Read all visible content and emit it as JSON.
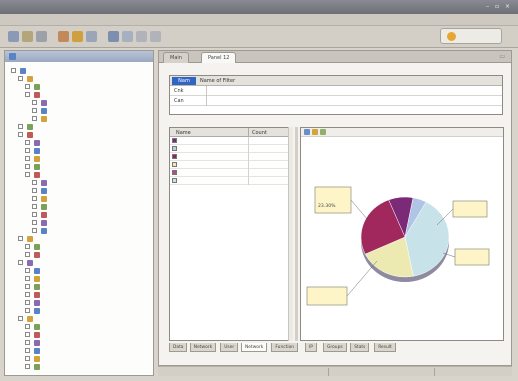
{
  "window": {
    "title": "",
    "controls": "– ▫ ×"
  },
  "menubar": {
    "items": [
      "",
      "",
      "",
      "",
      "",
      "",
      "",
      ""
    ]
  },
  "perspective": {
    "label": ""
  },
  "left_pane": {
    "tab_label": "",
    "tree": [
      {
        "label": "",
        "depth": 0,
        "expanded": true
      },
      {
        "label": "",
        "depth": 1,
        "expanded": true
      },
      {
        "label": "",
        "depth": 2,
        "expanded": false
      },
      {
        "label": "",
        "depth": 2,
        "expanded": true
      },
      {
        "label": "",
        "depth": 3,
        "expanded": false
      },
      {
        "label": "",
        "depth": 3,
        "expanded": false
      },
      {
        "label": "",
        "depth": 3,
        "expanded": false
      },
      {
        "label": "",
        "depth": 1,
        "expanded": false
      },
      {
        "label": "",
        "depth": 1,
        "expanded": true
      },
      {
        "label": "",
        "depth": 2,
        "expanded": false
      },
      {
        "label": "",
        "depth": 2,
        "expanded": false
      },
      {
        "label": "",
        "depth": 2,
        "expanded": false
      },
      {
        "label": "",
        "depth": 2,
        "expanded": false
      },
      {
        "label": "",
        "depth": 2,
        "expanded": false
      },
      {
        "label": "",
        "depth": 3,
        "expanded": false
      },
      {
        "label": "",
        "depth": 3,
        "expanded": false
      },
      {
        "label": "",
        "depth": 3,
        "expanded": false
      },
      {
        "label": "",
        "depth": 3,
        "expanded": false
      },
      {
        "label": "",
        "depth": 3,
        "expanded": false
      },
      {
        "label": "",
        "depth": 3,
        "expanded": false
      },
      {
        "label": "",
        "depth": 3,
        "expanded": false
      },
      {
        "label": "",
        "depth": 1,
        "expanded": true
      },
      {
        "label": "",
        "depth": 2,
        "expanded": false
      },
      {
        "label": "",
        "depth": 2,
        "expanded": false
      },
      {
        "label": "",
        "depth": 1,
        "expanded": true
      },
      {
        "label": "",
        "depth": 2,
        "expanded": false
      },
      {
        "label": "",
        "depth": 2,
        "expanded": false
      },
      {
        "label": "",
        "depth": 2,
        "expanded": false
      },
      {
        "label": "",
        "depth": 2,
        "expanded": false
      },
      {
        "label": "",
        "depth": 2,
        "expanded": false
      },
      {
        "label": "",
        "depth": 2,
        "expanded": false
      },
      {
        "label": "",
        "depth": 1,
        "expanded": true
      },
      {
        "label": "",
        "depth": 2,
        "expanded": false
      },
      {
        "label": "",
        "depth": 2,
        "expanded": false
      },
      {
        "label": "",
        "depth": 2,
        "expanded": false
      },
      {
        "label": "",
        "depth": 2,
        "expanded": false
      },
      {
        "label": "",
        "depth": 2,
        "expanded": false
      },
      {
        "label": "",
        "depth": 2,
        "expanded": false
      }
    ]
  },
  "editor": {
    "tabs": [
      {
        "label": "Main",
        "active": false
      },
      {
        "label": "Panel 12",
        "active": true
      }
    ],
    "section_title": "",
    "properties": {
      "header": {
        "name": "Nam",
        "value": "Name of Filter"
      },
      "rows": [
        {
          "key": "Cnk",
          "value": ""
        },
        {
          "key": "Can",
          "value": ""
        }
      ]
    },
    "section2_title": "",
    "grid": {
      "columns": [
        "Name",
        "Count"
      ],
      "rows": [
        {
          "name": "",
          "value": "",
          "color": "#7b2a78"
        },
        {
          "name": "",
          "value": "",
          "color": "#b7cfe6"
        },
        {
          "name": "",
          "value": "",
          "color": "#8d2455"
        },
        {
          "name": "",
          "value": "",
          "color": "#efeab2"
        },
        {
          "name": "",
          "value": "",
          "color": "#b84884"
        },
        {
          "name": "",
          "value": "",
          "color": "#c8e2ea"
        }
      ]
    },
    "bottom_tabs": [
      {
        "label": "Data",
        "active": false
      },
      {
        "label": "Network",
        "active": false
      },
      {
        "label": "User",
        "active": false
      },
      {
        "label": "Network",
        "active": true
      },
      {
        "label": "Function",
        "active": false
      },
      {
        "label": "IP",
        "active": false
      },
      {
        "label": "Groups",
        "active": false
      },
      {
        "label": "Stats",
        "active": false
      },
      {
        "label": "Result",
        "active": false
      }
    ]
  },
  "status": {
    "segments": [
      "",
      "",
      ""
    ]
  },
  "colors": {
    "accent": "#3164c4",
    "pie_slices": [
      "#c8e2ea",
      "#eceab0",
      "#a0285d",
      "#7b2a78",
      "#b0c4e6"
    ]
  },
  "chart_data": {
    "type": "pie",
    "slices": [
      {
        "label": "",
        "value": 0.39,
        "color": "#c8e2ea"
      },
      {
        "label": "",
        "value": 0.21,
        "color": "#eceab0"
      },
      {
        "label": "",
        "value": 0.26,
        "color": "#a0285d"
      },
      {
        "label": "",
        "value": 0.09,
        "color": "#7b2a78"
      },
      {
        "label": "",
        "value": 0.05,
        "color": "#b0c4e6"
      }
    ],
    "callouts": [
      {
        "line1": "",
        "line2": "23.30%"
      },
      {
        "line1": "",
        "line2": ""
      },
      {
        "line1": "",
        "line2": ""
      },
      {
        "line1": "",
        "line2": ""
      }
    ]
  }
}
